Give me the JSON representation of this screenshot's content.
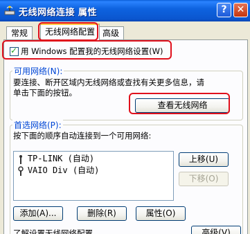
{
  "window": {
    "title": "无线网络连接 属性",
    "help_label": "?",
    "close_label": "✕"
  },
  "tabs": [
    {
      "label": "常规"
    },
    {
      "label": "无线网络配置"
    },
    {
      "label": "高级"
    }
  ],
  "config": {
    "checkbox_label": "用 Windows 配置我的无线网络设置(W)",
    "checked": true
  },
  "available": {
    "legend": "可用网络(N):",
    "description_line1": "要连接、断开区域内无线网络或查找有关更多信息，请",
    "description_line2": "单击下面的按钮。",
    "view_button": "查看无线网络"
  },
  "preferred": {
    "legend": "首选网络(P):",
    "description": "按下面的顺序自动连接到一个可用网络:",
    "items": [
      {
        "icon": "antenna-icon",
        "label": "TP-LINK (自动)"
      },
      {
        "icon": "antenna-disconnected-icon",
        "label": "VAIO Div (自动)"
      }
    ],
    "move_up": "上移(U)",
    "move_down": "下移(O)",
    "add": "添加(A)...",
    "remove": "删除(R)",
    "properties": "属性(O)"
  },
  "footer": {
    "learn_text": "了解设置无线网络配置。",
    "advanced_button": "高级(V)"
  },
  "colors": {
    "highlight": "#e0101c",
    "titlebar": "#0b56cf",
    "legend": "#0046d5"
  }
}
